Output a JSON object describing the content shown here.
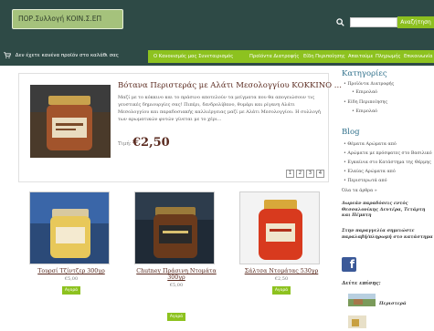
{
  "header": {
    "logo_text": "ΠΟΡ.Συλλογή ΚΟΙΝ.Σ.ΕΠ",
    "search": {
      "placeholder": "",
      "button_label": "Αναζήτηση"
    }
  },
  "nav": {
    "cart_text": "Δεν έχετε κανένα προϊόν στο καλάθι σας",
    "items": [
      "Ο Κανονισμός μας Συνεταιρισμός",
      "Προϊόντα Διατροφής",
      "Είδη Περιποίησης",
      "Απαιτούμε",
      "Πληρωμής",
      "Επικοινωνία"
    ]
  },
  "featured": {
    "title": "Βότανα Περιστεράς με Αλάτι Μεσολογγίου ΚΟΚΚΙΝΟ ...",
    "description": "Μαζί με το κόκκινο και το πράσινο αποτελούν τα μείγματα που θα απογειώσουν τις γευστικές δημιουργίες σας! Πιπέρι, δενδρολίβανο, θυμάρι και ρίγανη Αλάτι Μεσολογγίου και παραδοσιακής καλλιέργειας μαζί με Αλάτι Μεσολογγίου. Η συλλογή των αρωματικών φυτών γίνεται με το χέρι...",
    "price_label": "Τιμή:",
    "price": "€2,50",
    "pages": [
      "1",
      "2",
      "3",
      "4"
    ]
  },
  "products": [
    {
      "name": "Τουρσί Τζίντζερ 300γρ",
      "price": "€5,00",
      "buy": "Αγορά"
    },
    {
      "name": "Chutney Πράσινη Ντομάτα 300γρ",
      "price": "€5,00",
      "buy": "Αγορά"
    },
    {
      "name": "Σάλτσα Ντομάτας 530γρ",
      "price": "€2,50",
      "buy": "Αγορά"
    }
  ],
  "sidebar": {
    "categories_title": "Κατηγορίες",
    "categories": [
      {
        "label": "Προϊόντα Διατροφής",
        "level": 0
      },
      {
        "label": "Επιμολαό",
        "level": 1
      },
      {
        "label": "Είδη Περιποίησης",
        "level": 0
      },
      {
        "label": "Επιμολαό",
        "level": 1
      }
    ],
    "blog_title": "Blog",
    "blog_items": [
      "Θέματα Αρώματα από",
      "Αρώματα με πρόσφατες στο Βασιλικό",
      "Εγκαίνια στο Κατάστημα της Θέρμης",
      "Ελαίας Αρώματα από",
      "Περιστερωτά από"
    ],
    "all_articles": "Όλα τα άρθρα »",
    "delivery_text": "Δωρεάν παραδόσεις εντός Θεσσαλονίκης Δευτέρα, Τετάρτη και Πέμπτη",
    "order_text": "Στην παραγγελία σημειώστε παραλαβή/πληρωμή στο κατάστημα",
    "see_also": "Δείτε επίσης:",
    "see_also_link": "Περιστερά"
  },
  "colors": {
    "header_bg": "#2e4a46",
    "accent_green": "#8dc21f",
    "title_brown": "#5a2a1f",
    "sidebar_blue": "#2e6f8a"
  }
}
